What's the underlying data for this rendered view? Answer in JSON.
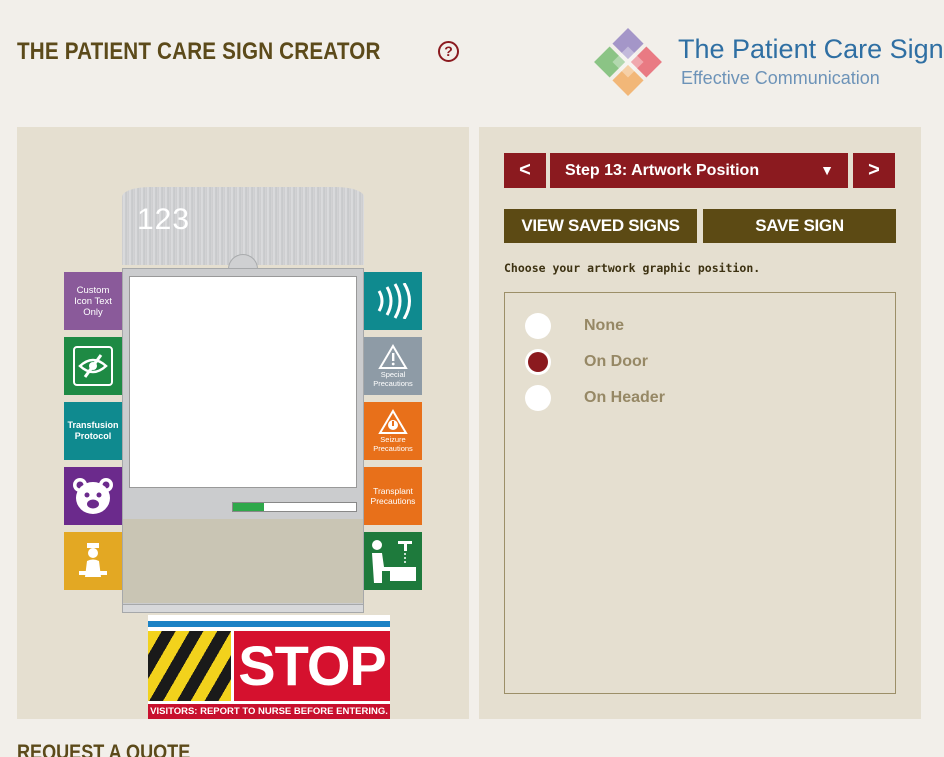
{
  "header": {
    "title": "THE PATIENT CARE SIGN CREATOR",
    "help_symbol": "?"
  },
  "logo": {
    "title": "The Patient Care Sign",
    "subtitle": "Effective Communication"
  },
  "preview": {
    "room_number": "123",
    "slider_fill": 0.25,
    "left_tiles": [
      {
        "label": "Custom Icon Text Only",
        "color": "#8a5a9a"
      },
      {
        "label": "",
        "icon": "eye-slash-icon",
        "color": "#1e8a44"
      },
      {
        "label": "Transfusion Protocol",
        "color": "#0f8a8f"
      },
      {
        "label": "",
        "icon": "teddy-bear-icon",
        "color": "#6b2a8c"
      },
      {
        "label": "",
        "icon": "nurse-icon",
        "color": "#e3a823"
      }
    ],
    "right_tiles": [
      {
        "label": "",
        "icon": "sound-waves-icon",
        "color": "#0f8a8f"
      },
      {
        "label": "Special Precautions",
        "icon": "warning-triangle-icon",
        "color": "#8e9ba6"
      },
      {
        "label": "Seizure Precautions",
        "icon": "seizure-icon",
        "color": "#e8701a"
      },
      {
        "label": "Transplant Precautions",
        "color": "#e8701a"
      },
      {
        "label": "",
        "icon": "hand-washing-icon",
        "color": "#1e7a3c"
      }
    ],
    "stop_sign": {
      "word": "STOP",
      "message": "VISITORS: REPORT TO NURSE BEFORE ENTERING."
    }
  },
  "controls": {
    "prev_symbol": "<",
    "next_symbol": ">",
    "step_label": "Step 13: Artwork Position",
    "caret": "▼",
    "view_saved": "VIEW SAVED SIGNS",
    "save": "SAVE SIGN",
    "instruction": "Choose your artwork graphic position.",
    "options": [
      {
        "label": "None",
        "selected": false
      },
      {
        "label": "On Door",
        "selected": true
      },
      {
        "label": "On Header",
        "selected": false
      }
    ]
  },
  "footer": {
    "quote_heading": "REQUEST A QUOTE"
  },
  "colors": {
    "brand_dark_red": "#8b1a1f",
    "brand_olive": "#5c4a14",
    "panel_bg": "#e5dfd0",
    "page_bg": "#f2efea"
  }
}
